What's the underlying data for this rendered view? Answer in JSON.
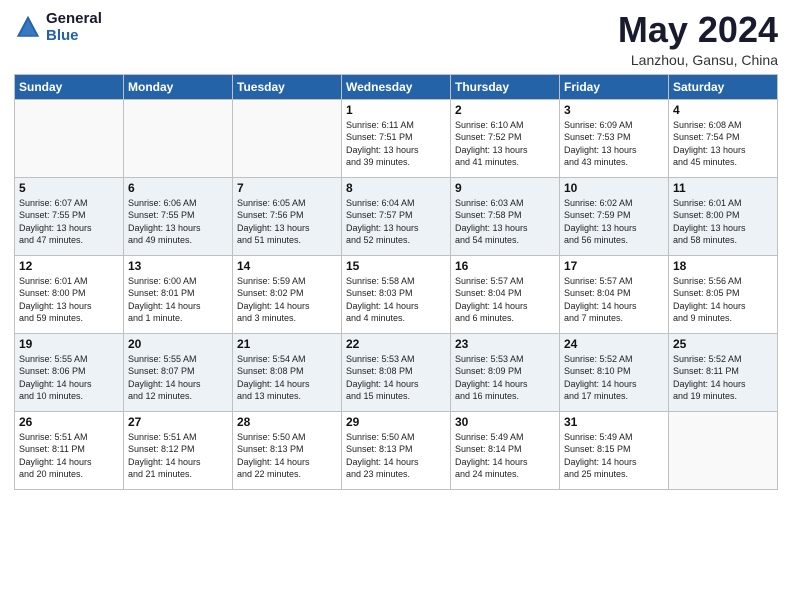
{
  "header": {
    "logo_line1": "General",
    "logo_line2": "Blue",
    "month_title": "May 2024",
    "location": "Lanzhou, Gansu, China"
  },
  "days_of_week": [
    "Sunday",
    "Monday",
    "Tuesday",
    "Wednesday",
    "Thursday",
    "Friday",
    "Saturday"
  ],
  "weeks": [
    [
      {
        "day": "",
        "info": ""
      },
      {
        "day": "",
        "info": ""
      },
      {
        "day": "",
        "info": ""
      },
      {
        "day": "1",
        "info": "Sunrise: 6:11 AM\nSunset: 7:51 PM\nDaylight: 13 hours\nand 39 minutes."
      },
      {
        "day": "2",
        "info": "Sunrise: 6:10 AM\nSunset: 7:52 PM\nDaylight: 13 hours\nand 41 minutes."
      },
      {
        "day": "3",
        "info": "Sunrise: 6:09 AM\nSunset: 7:53 PM\nDaylight: 13 hours\nand 43 minutes."
      },
      {
        "day": "4",
        "info": "Sunrise: 6:08 AM\nSunset: 7:54 PM\nDaylight: 13 hours\nand 45 minutes."
      }
    ],
    [
      {
        "day": "5",
        "info": "Sunrise: 6:07 AM\nSunset: 7:55 PM\nDaylight: 13 hours\nand 47 minutes."
      },
      {
        "day": "6",
        "info": "Sunrise: 6:06 AM\nSunset: 7:55 PM\nDaylight: 13 hours\nand 49 minutes."
      },
      {
        "day": "7",
        "info": "Sunrise: 6:05 AM\nSunset: 7:56 PM\nDaylight: 13 hours\nand 51 minutes."
      },
      {
        "day": "8",
        "info": "Sunrise: 6:04 AM\nSunset: 7:57 PM\nDaylight: 13 hours\nand 52 minutes."
      },
      {
        "day": "9",
        "info": "Sunrise: 6:03 AM\nSunset: 7:58 PM\nDaylight: 13 hours\nand 54 minutes."
      },
      {
        "day": "10",
        "info": "Sunrise: 6:02 AM\nSunset: 7:59 PM\nDaylight: 13 hours\nand 56 minutes."
      },
      {
        "day": "11",
        "info": "Sunrise: 6:01 AM\nSunset: 8:00 PM\nDaylight: 13 hours\nand 58 minutes."
      }
    ],
    [
      {
        "day": "12",
        "info": "Sunrise: 6:01 AM\nSunset: 8:00 PM\nDaylight: 13 hours\nand 59 minutes."
      },
      {
        "day": "13",
        "info": "Sunrise: 6:00 AM\nSunset: 8:01 PM\nDaylight: 14 hours\nand 1 minute."
      },
      {
        "day": "14",
        "info": "Sunrise: 5:59 AM\nSunset: 8:02 PM\nDaylight: 14 hours\nand 3 minutes."
      },
      {
        "day": "15",
        "info": "Sunrise: 5:58 AM\nSunset: 8:03 PM\nDaylight: 14 hours\nand 4 minutes."
      },
      {
        "day": "16",
        "info": "Sunrise: 5:57 AM\nSunset: 8:04 PM\nDaylight: 14 hours\nand 6 minutes."
      },
      {
        "day": "17",
        "info": "Sunrise: 5:57 AM\nSunset: 8:04 PM\nDaylight: 14 hours\nand 7 minutes."
      },
      {
        "day": "18",
        "info": "Sunrise: 5:56 AM\nSunset: 8:05 PM\nDaylight: 14 hours\nand 9 minutes."
      }
    ],
    [
      {
        "day": "19",
        "info": "Sunrise: 5:55 AM\nSunset: 8:06 PM\nDaylight: 14 hours\nand 10 minutes."
      },
      {
        "day": "20",
        "info": "Sunrise: 5:55 AM\nSunset: 8:07 PM\nDaylight: 14 hours\nand 12 minutes."
      },
      {
        "day": "21",
        "info": "Sunrise: 5:54 AM\nSunset: 8:08 PM\nDaylight: 14 hours\nand 13 minutes."
      },
      {
        "day": "22",
        "info": "Sunrise: 5:53 AM\nSunset: 8:08 PM\nDaylight: 14 hours\nand 15 minutes."
      },
      {
        "day": "23",
        "info": "Sunrise: 5:53 AM\nSunset: 8:09 PM\nDaylight: 14 hours\nand 16 minutes."
      },
      {
        "day": "24",
        "info": "Sunrise: 5:52 AM\nSunset: 8:10 PM\nDaylight: 14 hours\nand 17 minutes."
      },
      {
        "day": "25",
        "info": "Sunrise: 5:52 AM\nSunset: 8:11 PM\nDaylight: 14 hours\nand 19 minutes."
      }
    ],
    [
      {
        "day": "26",
        "info": "Sunrise: 5:51 AM\nSunset: 8:11 PM\nDaylight: 14 hours\nand 20 minutes."
      },
      {
        "day": "27",
        "info": "Sunrise: 5:51 AM\nSunset: 8:12 PM\nDaylight: 14 hours\nand 21 minutes."
      },
      {
        "day": "28",
        "info": "Sunrise: 5:50 AM\nSunset: 8:13 PM\nDaylight: 14 hours\nand 22 minutes."
      },
      {
        "day": "29",
        "info": "Sunrise: 5:50 AM\nSunset: 8:13 PM\nDaylight: 14 hours\nand 23 minutes."
      },
      {
        "day": "30",
        "info": "Sunrise: 5:49 AM\nSunset: 8:14 PM\nDaylight: 14 hours\nand 24 minutes."
      },
      {
        "day": "31",
        "info": "Sunrise: 5:49 AM\nSunset: 8:15 PM\nDaylight: 14 hours\nand 25 minutes."
      },
      {
        "day": "",
        "info": ""
      }
    ]
  ]
}
